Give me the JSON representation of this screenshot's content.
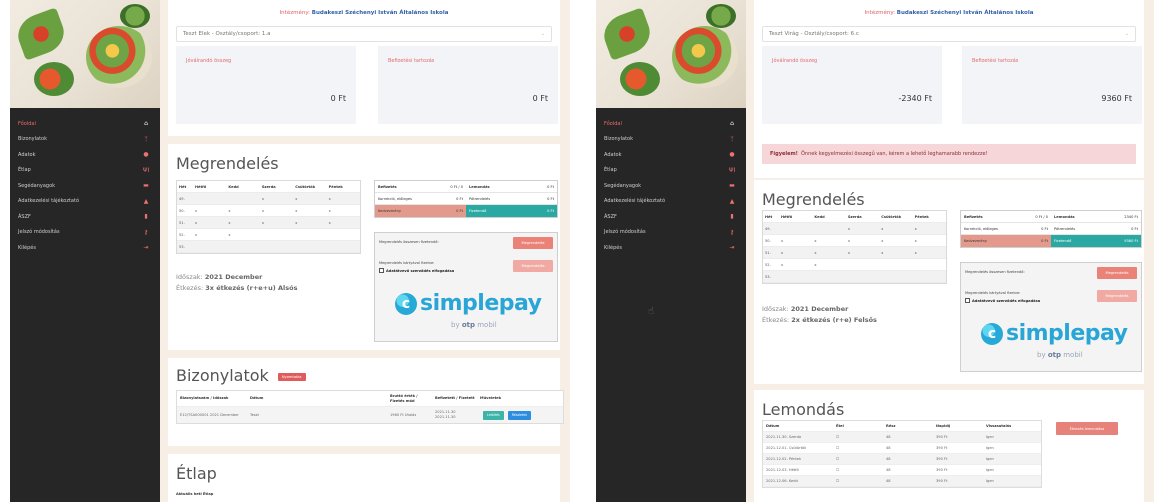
{
  "left": {
    "menu": [
      {
        "label": "Főoldal",
        "icon": "home-icon",
        "glyph": "⌂",
        "active": true
      },
      {
        "label": "Bizonylatok",
        "icon": "receipt-icon",
        "glyph": "ᛉ",
        "active": false
      },
      {
        "label": "Adatok",
        "icon": "user-icon",
        "glyph": "●",
        "active": false
      },
      {
        "label": "Étlap",
        "icon": "cutlery-icon",
        "glyph": "ΨΙ",
        "active": false
      },
      {
        "label": "Segédanyagok",
        "icon": "card-icon",
        "glyph": "▬",
        "active": false
      },
      {
        "label": "Adatkezelési tájékoztató",
        "icon": "user-secret-icon",
        "glyph": "▲",
        "active": false
      },
      {
        "label": "ÁSZF",
        "icon": "document-icon",
        "glyph": "▮",
        "active": false
      },
      {
        "label": "Jelszó módosítás",
        "icon": "key-icon",
        "glyph": "⚷",
        "active": false
      },
      {
        "label": "Kilépés",
        "icon": "logout-icon",
        "glyph": "⇥",
        "active": false
      }
    ],
    "school_label": "Intézmény:",
    "school_name": "Budakeszi Széchenyi István Általános Iskola",
    "student_select": "Teszt Elek - Osztály/csoport: 1.a",
    "balance_label": "Jóváírandó összeg",
    "balance_value": "0 Ft",
    "payable_label": "Befizetési tartozás",
    "payable_value": "0 Ft",
    "order_title": "Megrendelés",
    "grid_headers": [
      "Hét",
      "Hétfő",
      "Kedd",
      "Szerda",
      "Csütörtök",
      "Péntek"
    ],
    "grid_rows": [
      [
        "49.",
        "",
        "",
        "x",
        "x",
        "x"
      ],
      [
        "50.",
        "x",
        "x",
        "x",
        "x",
        "x"
      ],
      [
        "51.",
        "x",
        "x",
        "x",
        "x",
        "x"
      ],
      [
        "52.",
        "x",
        "x",
        "",
        "",
        ""
      ],
      [
        "53.",
        "",
        "",
        "",
        "",
        ""
      ]
    ],
    "summary": {
      "r1_left_label": "Befizetés",
      "r1_left_value": "0 Ft / 0",
      "r1_right_label": "Lemondás",
      "r1_right_value": "0 Ft",
      "r2_left_label": "Korrekció, előleges",
      "r2_left_value": "0 Ft",
      "r2_right_label": "Pótrendelés",
      "r2_right_value": "0 Ft",
      "r3_left_label": "Kedvezmény",
      "r3_left_value": "0 Ft",
      "r3_right_label": "Fizetendő",
      "r3_right_value": "0 Ft"
    },
    "pay_line1": "Megrendelés összesen fizetendő:",
    "pay_btn1": "Megrendelés",
    "pay_line2": "Megrendelés kártyával fizetve:",
    "pay_checkbox": "Adatátvevő szerződés elfogadása",
    "pay_btn2": "Megrendelés",
    "info_period_label": "Időszak:",
    "info_period_value": "2021 December",
    "info_meal_label": "Étkezés:",
    "info_meal_value": "3x étkezés (r+e+u) Alsós",
    "simplepay_text": "simplepay",
    "simplepay_by": "by",
    "simplepay_bank": "otp",
    "simplepay_bank_tail": "mobil",
    "docs_title": "Bizonylatok",
    "docs_tag": "Nyomtatás",
    "docs_headers": [
      "Bizonylatszám / Időszak",
      "Dátum",
      "Bruttó érték / Fizetés mód",
      "Befizetett / Fizetett",
      "Műveletek"
    ],
    "docs_row": [
      "E12/TSA000001 2021 December",
      "Teszt",
      "1960 Ft Utalás",
      "2021.11.30 2021.11.30"
    ],
    "docs_buttons": [
      "Letöltés",
      "Részletek"
    ],
    "menu_title": "Étlap",
    "menu_sub": "Aktuális heti Étlap"
  },
  "right": {
    "menu": [
      {
        "label": "Főoldal",
        "icon": "home-icon",
        "glyph": "⌂",
        "active": true
      },
      {
        "label": "Bizonylatok",
        "icon": "receipt-icon",
        "glyph": "ᛉ",
        "active": false
      },
      {
        "label": "Adatok",
        "icon": "user-icon",
        "glyph": "●",
        "active": false
      },
      {
        "label": "Étlap",
        "icon": "cutlery-icon",
        "glyph": "ΨΙ",
        "active": false
      },
      {
        "label": "Segédanyagok",
        "icon": "card-icon",
        "glyph": "▬",
        "active": false
      },
      {
        "label": "Adatkezelési tájékoztató",
        "icon": "user-secret-icon",
        "glyph": "▲",
        "active": false
      },
      {
        "label": "ÁSZF",
        "icon": "document-icon",
        "glyph": "▮",
        "active": false
      },
      {
        "label": "Jelszó módosítás",
        "icon": "key-icon",
        "glyph": "⚷",
        "active": false
      },
      {
        "label": "Kilépés",
        "icon": "logout-icon",
        "glyph": "⇥",
        "active": false
      }
    ],
    "school_label": "Intézmény:",
    "school_name": "Budakeszi Széchenyi István Általános Iskola",
    "student_select": "Teszt Virág - Osztály/csoport: 6.c",
    "balance_label": "Jóváírandó összeg",
    "balance_value": "-2340 Ft",
    "payable_label": "Befizetési tartozás",
    "payable_value": "9360 Ft",
    "alert_bold": "Figyelem!",
    "alert_text": "Önnek kegyelmezési összegű van, kérem a lehető leghamarabb rendezze!",
    "order_title": "Megrendelés",
    "grid_headers": [
      "Hét",
      "Hétfő",
      "Kedd",
      "Szerda",
      "Csütörtök",
      "Péntek"
    ],
    "grid_rows": [
      [
        "49.",
        "",
        "",
        "x",
        "x",
        "x"
      ],
      [
        "50.",
        "x",
        "x",
        "x",
        "x",
        "x"
      ],
      [
        "51.",
        "x",
        "x",
        "x",
        "x",
        "x"
      ],
      [
        "52.",
        "x",
        "x",
        "",
        "",
        ""
      ],
      [
        "53.",
        "",
        "",
        "",
        "",
        ""
      ]
    ],
    "summary": {
      "r1_left_label": "Befizetés",
      "r1_left_value": "0 Ft / 0",
      "r1_right_label": "Lemondás",
      "r1_right_value": "2340 Ft",
      "r2_left_label": "Korrekció, előleges",
      "r2_left_value": "0 Ft",
      "r2_right_label": "Pótrendelés",
      "r2_right_value": "0 Ft",
      "r3_left_label": "Kedvezmény",
      "r3_left_value": "0 Ft",
      "r3_right_label": "Fizetendő",
      "r3_right_value": "9360 Ft"
    },
    "pay_line1": "Megrendelés összesen fizetendő:",
    "pay_btn1": "Megrendelés",
    "pay_line2": "Megrendelés kártyával fizetve:",
    "pay_checkbox": "Adatátvevő szerződés elfogadása",
    "pay_btn2": "Megrendelés",
    "info_period_label": "Időszak:",
    "info_period_value": "2021 December",
    "info_meal_label": "Étkezés:",
    "info_meal_value": "2x étkezés (r+e) Felsős",
    "simplepay_text": "simplepay",
    "simplepay_by": "by",
    "simplepay_bank": "otp",
    "simplepay_bank_tail": "mobil",
    "lem_title": "Lemondás",
    "lem_button": "Étkezés lemondása",
    "lem_headers": [
      "Dátum",
      "Étel",
      "Rész",
      "Napidíj",
      "Visszautalás"
    ],
    "lem_rows": [
      [
        "2021.11.30. Szerda",
        "☐",
        "48",
        "390 Ft",
        "Igen"
      ],
      [
        "2021.12.01. Csütörtök",
        "☐",
        "48",
        "390 Ft",
        "Igen"
      ],
      [
        "2021.12.02. Péntek",
        "☐",
        "48",
        "390 Ft",
        "Igen"
      ],
      [
        "2021.12.03. Hétfő",
        "☐",
        "48",
        "390 Ft",
        "Igen"
      ],
      [
        "2021.12.06. Kedd",
        "☐",
        "48",
        "390 Ft",
        "Igen"
      ]
    ]
  }
}
